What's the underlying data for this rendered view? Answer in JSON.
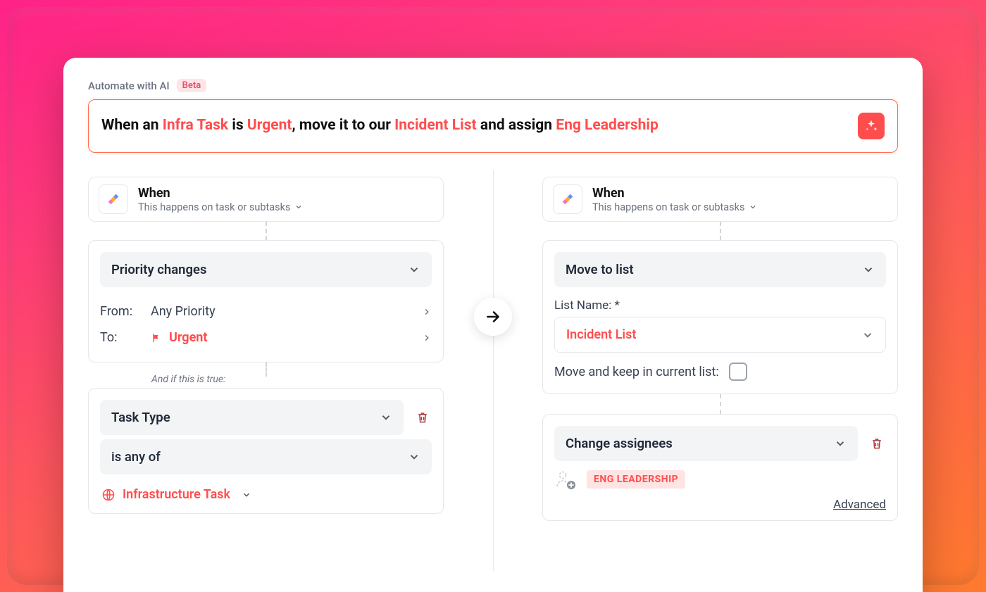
{
  "header": {
    "title": "Automate with AI",
    "badge": "Beta"
  },
  "prompt": {
    "seg1": "When an ",
    "h1": "Infra Task",
    "seg2": " is ",
    "h2": "Urgent",
    "seg3": ", move it to our ",
    "h3": "Incident List",
    "seg4": " and assign ",
    "h4": "Eng Leadership"
  },
  "left": {
    "when_title": "When",
    "when_sub": "This happens on task or subtasks",
    "trigger": {
      "label": "Priority changes",
      "from_label": "From:",
      "from_value": "Any Priority",
      "to_label": "To:",
      "to_value": "Urgent"
    },
    "condition_intro": "And if this is true:",
    "condition": {
      "field": "Task Type",
      "op": "is any of",
      "value": "Infrastructure Task"
    }
  },
  "right": {
    "when_title": "When",
    "when_sub": "This happens on task or subtasks",
    "action_move": {
      "label": "Move to list",
      "field_label": "List Name: *",
      "list_value": "Incident List",
      "keep_label": "Move and keep in current list:"
    },
    "action_assign": {
      "label": "Change assignees",
      "team": "ENG LEADERSHIP",
      "advanced": "Advanced"
    }
  }
}
